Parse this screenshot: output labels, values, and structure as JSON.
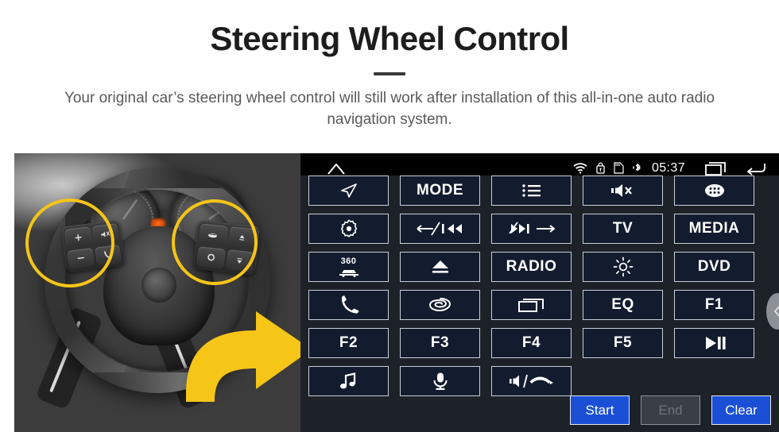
{
  "header": {
    "title": "Steering Wheel Control",
    "subtitle": "Your original car’s steering wheel control will still work after installation of this all-in-one auto radio navigation system."
  },
  "photo": {
    "alt_name": "steering-wheel-photo",
    "highlight_color": "#f5c518",
    "arrow_color": "#f5c518",
    "left_pad_buttons": [
      {
        "name": "volume-up-button",
        "glyph": "+"
      },
      {
        "name": "mute-button",
        "glyph": "mute-icon"
      },
      {
        "name": "volume-down-button",
        "glyph": "−"
      },
      {
        "name": "phone-button",
        "glyph": "phone-icon"
      }
    ],
    "right_pad_buttons": [
      {
        "name": "cruise-control-button",
        "glyph": "cruise-icon"
      },
      {
        "name": "up-button",
        "glyph": "up-arrow-icon"
      },
      {
        "name": "circle-button",
        "glyph": "circle-icon"
      },
      {
        "name": "down-button",
        "glyph": "down-arrow-icon"
      }
    ]
  },
  "statusbar": {
    "home_icon": "home-icon",
    "wifi_icon": "wifi-icon",
    "lock_icon": "lock-icon",
    "sdcard_icon": "sd-card-icon",
    "bluetooth_icon": "bluetooth-icon",
    "time": "05:37",
    "recents_icon": "recents-icon",
    "back_icon": "back-icon"
  },
  "keymap": {
    "accent_blue": "#1b4fd6",
    "button_fill": "#131c2e",
    "panel_bg": "#1d2228",
    "rows": [
      [
        {
          "name": "navigation-button",
          "type": "icon",
          "icon": "navigation-arrow-icon",
          "label": ""
        },
        {
          "name": "mode-button",
          "type": "text",
          "icon": "",
          "label": "MODE"
        },
        {
          "name": "list-button",
          "type": "icon",
          "icon": "list-icon",
          "label": ""
        },
        {
          "name": "mute-button",
          "type": "icon",
          "icon": "speaker-mute-icon",
          "label": ""
        },
        {
          "name": "apps-button",
          "type": "icon",
          "icon": "apps-grid-icon",
          "label": ""
        }
      ],
      [
        {
          "name": "settings-button",
          "type": "icon",
          "icon": "gear-dot-icon",
          "label": ""
        },
        {
          "name": "previous-track-button",
          "type": "icon",
          "icon": "prev-track-icon",
          "label": ""
        },
        {
          "name": "next-track-button",
          "type": "icon",
          "icon": "next-track-icon",
          "label": ""
        },
        {
          "name": "tv-button",
          "type": "text",
          "icon": "",
          "label": "TV"
        },
        {
          "name": "media-button",
          "type": "text",
          "icon": "",
          "label": "MEDIA"
        }
      ],
      [
        {
          "name": "camera-360-button",
          "type": "icon",
          "icon": "car-360-icon",
          "label": "360"
        },
        {
          "name": "eject-button",
          "type": "icon",
          "icon": "eject-icon",
          "label": ""
        },
        {
          "name": "radio-button",
          "type": "text",
          "icon": "",
          "label": "RADIO"
        },
        {
          "name": "brightness-button",
          "type": "icon",
          "icon": "brightness-icon",
          "label": ""
        },
        {
          "name": "dvd-button",
          "type": "text",
          "icon": "",
          "label": "DVD"
        }
      ],
      [
        {
          "name": "phone-button",
          "type": "icon",
          "icon": "phone-icon",
          "label": ""
        },
        {
          "name": "swirl-button",
          "type": "icon",
          "icon": "swirl-icon",
          "label": ""
        },
        {
          "name": "window-button",
          "type": "icon",
          "icon": "window-icon",
          "label": ""
        },
        {
          "name": "eq-button",
          "type": "text",
          "icon": "",
          "label": "EQ"
        },
        {
          "name": "f1-button",
          "type": "text",
          "icon": "",
          "label": "F1"
        }
      ],
      [
        {
          "name": "f2-button",
          "type": "text",
          "icon": "",
          "label": "F2"
        },
        {
          "name": "f3-button",
          "type": "text",
          "icon": "",
          "label": "F3"
        },
        {
          "name": "f4-button",
          "type": "text",
          "icon": "",
          "label": "F4"
        },
        {
          "name": "f5-button",
          "type": "text",
          "icon": "",
          "label": "F5"
        },
        {
          "name": "play-pause-button",
          "type": "icon",
          "icon": "play-pause-icon",
          "label": ""
        }
      ],
      [
        {
          "name": "music-button",
          "type": "icon",
          "icon": "music-note-icon",
          "label": ""
        },
        {
          "name": "microphone-button",
          "type": "icon",
          "icon": "microphone-icon",
          "label": ""
        },
        {
          "name": "volume-hangup-button",
          "type": "icon",
          "icon": "volume-hangup-icon",
          "label": ""
        }
      ]
    ]
  },
  "actions": [
    {
      "name": "start-button",
      "label": "Start",
      "state": "enabled"
    },
    {
      "name": "end-button",
      "label": "End",
      "state": "disabled"
    },
    {
      "name": "clear-button",
      "label": "Clear",
      "state": "enabled"
    }
  ],
  "edge_tab": {
    "name": "panel-pull-tab",
    "icon": "chevron-left-icon"
  }
}
